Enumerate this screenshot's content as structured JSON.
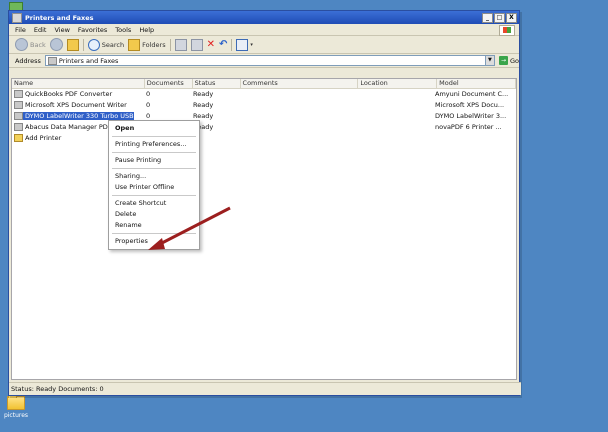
{
  "desktop": {
    "folder_label": "pictures"
  },
  "window": {
    "title": "Printers and Faxes",
    "controls": [
      "_",
      "□",
      "X"
    ],
    "menu": [
      "File",
      "Edit",
      "View",
      "Favorites",
      "Tools",
      "Help"
    ],
    "toolbar": {
      "back": "Back",
      "search": "Search",
      "folders": "Folders"
    },
    "address": {
      "label": "Address",
      "value": "Printers and Faxes",
      "go_label": "Go"
    }
  },
  "list": {
    "columns": [
      "Name",
      "Documents",
      "Status",
      "Comments",
      "Location",
      "Model"
    ],
    "rows": [
      {
        "name": "QuickBooks PDF Converter",
        "documents": "0",
        "status": "Ready",
        "comments": "",
        "location": "",
        "model": "Amyuni Document C..."
      },
      {
        "name": "Microsoft XPS Document Writer",
        "documents": "0",
        "status": "Ready",
        "comments": "",
        "location": "",
        "model": "Microsoft XPS Docu..."
      },
      {
        "name": "DYMO LabelWriter 330 Turbo USB",
        "documents": "0",
        "status": "Ready",
        "comments": "",
        "location": "",
        "model": "DYMO LabelWriter 3..."
      },
      {
        "name": "Abacus Data Manager PD",
        "documents": "0",
        "status": "Ready",
        "comments": "",
        "location": "",
        "model": "novaPDF 6 Printer ..."
      }
    ],
    "add_printer": "Add Printer"
  },
  "context_menu": {
    "items": [
      "Open",
      "Printing Preferences...",
      "Pause Printing",
      "Sharing...",
      "Use Printer Offline",
      "Create Shortcut",
      "Delete",
      "Rename",
      "Properties"
    ]
  },
  "status_bar": {
    "text": "Status: Ready Documents: 0"
  },
  "colors": {
    "desktop": "#4e86c2",
    "selection": "#2f5fc8",
    "arrow": "#9c1f1f"
  }
}
